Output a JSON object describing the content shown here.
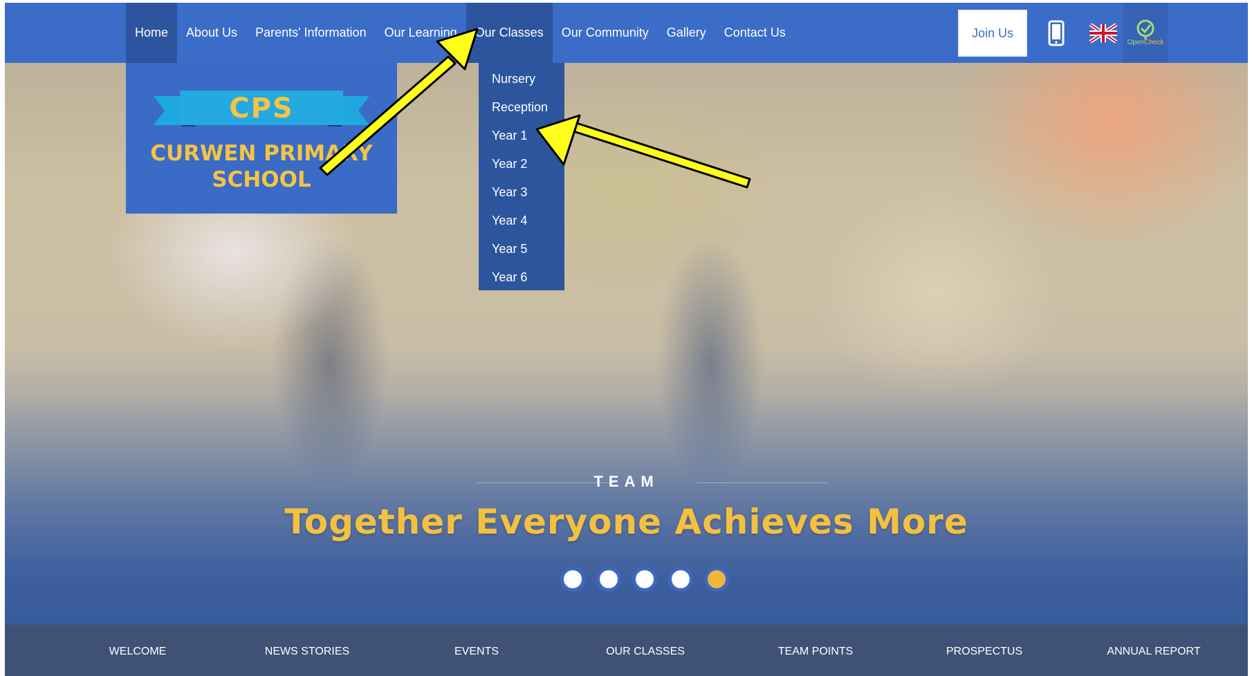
{
  "nav": {
    "items": [
      "Home",
      "About Us",
      "Parents' Information",
      "Our Learning",
      "Our Classes",
      "Our Community",
      "Gallery",
      "Contact Us"
    ],
    "join_label": "Join Us",
    "opencheck_label_a": "Open",
    "opencheck_label_b": "Check"
  },
  "logo": {
    "acronym": "CPS",
    "name_line1": "CURWEN PRIMARY",
    "name_line2": "SCHOOL"
  },
  "dropdown": {
    "items": [
      "Nursery",
      "Reception",
      "Year 1",
      "Year 2",
      "Year 3",
      "Year 4",
      "Year 5",
      "Year 6"
    ]
  },
  "hero": {
    "eyebrow": "TEAM",
    "slogan": "Together Everyone Achieves More",
    "slides_count": 5,
    "active_slide": 5
  },
  "bottom_nav": [
    "WELCOME",
    "NEWS STORIES",
    "EVENTS",
    "OUR CLASSES",
    "TEAM POINTS",
    "PROSPECTUS",
    "ANNUAL REPORT"
  ],
  "colors": {
    "nav_bg": "#3b6cc8",
    "nav_active": "#2c559e",
    "accent_yellow": "#f5c443",
    "bottom_bar": "#3f5175",
    "arrow": "#ffff1a"
  }
}
